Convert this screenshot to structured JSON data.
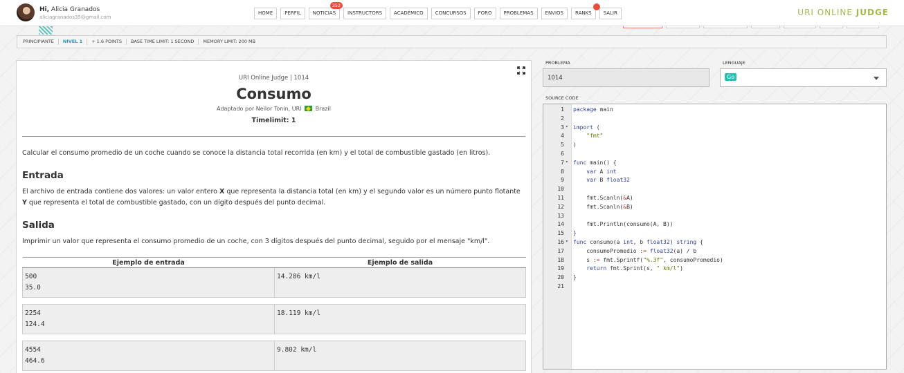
{
  "user": {
    "greeting_bold": "Hi,",
    "name": "Alicia Granados",
    "email": "aliciagranados35@gmail.com"
  },
  "nav": [
    {
      "label": "HOME"
    },
    {
      "label": "PERFIL"
    },
    {
      "label": "NOTICIAS",
      "badge": "352"
    },
    {
      "label": "INSTRUCTORS"
    },
    {
      "label": "ACADÉMICO"
    },
    {
      "label": "CONCURSOS"
    },
    {
      "label": "FORO"
    },
    {
      "label": "PROBLEMAS"
    },
    {
      "label": "ENVIOS"
    },
    {
      "label": "RANKS"
    },
    {
      "label": "SALIR"
    }
  ],
  "logo": {
    "part1": "URI ONLINE ",
    "part2": "JUDGE"
  },
  "info": {
    "category": "PRINCIPIANTE",
    "level": "NIVEL 1",
    "points": "+ 1.6 POINTS",
    "time_limit": "BASE TIME LIMIT: 1 SECOND",
    "memory": "MEMORY LIMIT: 200 MB"
  },
  "problem": {
    "source": "URI Online Judge | 1014",
    "title": "Consumo",
    "adapted_prefix": "Adaptado por Neilor Tonin, URI",
    "adapted_country": "Brazil",
    "timelimit": "Timelimit: 1",
    "description": "Calcular el consumo promedio de un coche cuando se conoce la distancia total recorrida (en km) y el total de combustible gastado (en litros).",
    "input_heading": "Entrada",
    "input_text_1": "El archivo de entrada contiene dos valores: un valor entero ",
    "input_var_x": "X",
    "input_text_2": " que representa la distancia total (en km) y el segundo valor es un número punto flotante ",
    "input_var_y": "Y",
    "input_text_3": "  que representa el total de combustible gastado, con un dígito después del punto decimal.",
    "output_heading": "Salida",
    "output_text": "Imprimir un valor que representa el consumo promedio de un coche, con 3 dígitos después del punto decimal, seguido por el mensaje \"km/l\".",
    "examples_input_header": "Ejemplo de entrada",
    "examples_output_header": "Ejemplo de salida",
    "examples": [
      {
        "input": "500\n35.0",
        "output": "14.286 km/l"
      },
      {
        "input": "2254\n124.4",
        "output": "18.119 km/l"
      },
      {
        "input": "4554\n464.6",
        "output": "9.802 km/l"
      }
    ]
  },
  "form": {
    "problem_label": "PROBLEMA",
    "problem_value": "1014",
    "language_label": "LENGUAJE",
    "language_value": "Go",
    "source_label": "SOURCE CODE"
  },
  "code_lines": [
    "package main",
    "",
    "import (",
    "    \"fmt\"",
    ")",
    "",
    "func main() {",
    "    var A int",
    "    var B float32",
    "",
    "    fmt.Scanln(&A)",
    "    fmt.Scanln(&B)",
    "",
    "    fmt.Println(consumo(A, B))",
    "}",
    "func consumo(a int, b float32) string {",
    "    consumoPromedio := float32(a) / b",
    "    s := fmt.Sprintf(\"%.3f\", consumoPromedio)",
    "    return fmt.Sprint(s, \" km/l\")",
    "}",
    ""
  ],
  "fold_lines": [
    3,
    7,
    16
  ]
}
